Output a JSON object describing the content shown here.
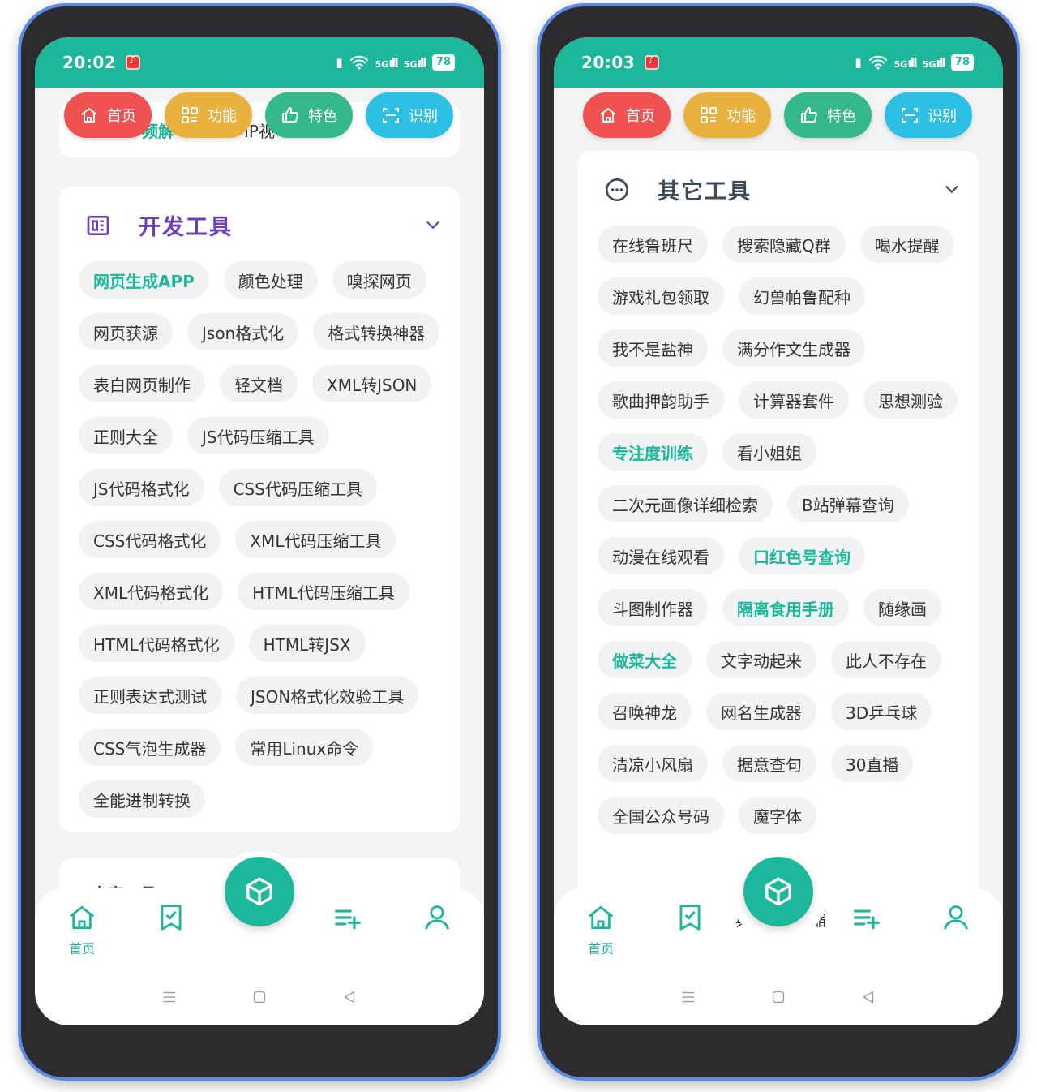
{
  "colors": {
    "brand": "#1db79b",
    "tab_home": "#f05252",
    "tab_function": "#e9b23f",
    "tab_feature": "#35b98a",
    "tab_recognize": "#2ec0e4",
    "dev_title": "#6b3fb8",
    "other_title": "#3d4a5a"
  },
  "tabs": [
    {
      "label": "首页",
      "icon": "home-icon"
    },
    {
      "label": "功能",
      "icon": "grid-icon"
    },
    {
      "label": "特色",
      "icon": "thumbs-up-icon"
    },
    {
      "label": "识别",
      "icon": "scan-icon"
    }
  ],
  "bottom_nav": {
    "home_label": "首页",
    "items": [
      "home-icon",
      "bookmark-check-icon",
      "cube-icon",
      "playlist-add-icon",
      "user-icon"
    ]
  },
  "left": {
    "status": {
      "time": "20:02",
      "signal_1": "5G",
      "signal_2": "5G",
      "battery": "78"
    },
    "peek": {
      "a": "频解",
      "b": "IP视"
    },
    "dev_tools": {
      "title": "开发工具",
      "chips": [
        {
          "label": "网页生成APP",
          "hl": true
        },
        {
          "label": "颜色处理"
        },
        {
          "label": "嗅探网页"
        },
        {
          "label": "网页获源"
        },
        {
          "label": "Json格式化"
        },
        {
          "label": "格式转换神器"
        },
        {
          "label": "表白网页制作"
        },
        {
          "label": "轻文档"
        },
        {
          "label": "XML转JSON"
        },
        {
          "label": "正则大全"
        },
        {
          "label": "JS代码压缩工具"
        },
        {
          "label": "JS代码格式化"
        },
        {
          "label": "CSS代码压缩工具"
        },
        {
          "label": "CSS代码格式化"
        },
        {
          "label": "XML代码压缩工具"
        },
        {
          "label": "XML代码格式化"
        },
        {
          "label": "HTML代码压缩工具"
        },
        {
          "label": "HTML代码格式化"
        },
        {
          "label": "HTML转JSX"
        },
        {
          "label": "正则表达式测试"
        },
        {
          "label": "JSON格式化效验工具"
        },
        {
          "label": "CSS气泡生成器"
        },
        {
          "label": "常用Linux命令"
        },
        {
          "label": "全能进制转换"
        }
      ]
    },
    "next_section_peek": "文字工具"
  },
  "right": {
    "status": {
      "time": "20:03",
      "signal_1": "5G",
      "signal_2": "5G",
      "battery": "78"
    },
    "other_tools": {
      "title": "其它工具",
      "chips": [
        {
          "label": "在线鲁班尺"
        },
        {
          "label": "搜索隐藏Q群"
        },
        {
          "label": "喝水提醒"
        },
        {
          "label": "游戏礼包领取"
        },
        {
          "label": "幻兽帕鲁配种"
        },
        {
          "label": "我不是盐神"
        },
        {
          "label": "满分作文生成器"
        },
        {
          "label": "歌曲押韵助手"
        },
        {
          "label": "计算器套件"
        },
        {
          "label": "思想测验"
        },
        {
          "label": "专注度训练",
          "hl": true
        },
        {
          "label": "看小姐姐"
        },
        {
          "label": "二次元画像详细检索"
        },
        {
          "label": "B站弹幕查询"
        },
        {
          "label": "动漫在线观看"
        },
        {
          "label": "口红色号查询",
          "hl": true
        },
        {
          "label": "斗图制作器"
        },
        {
          "label": "隔离食用手册",
          "hl": true
        },
        {
          "label": "随缘画"
        },
        {
          "label": "做菜大全",
          "hl": true
        },
        {
          "label": "文字动起来"
        },
        {
          "label": "此人不存在"
        },
        {
          "label": "召唤神龙"
        },
        {
          "label": "网名生成器"
        },
        {
          "label": "3D乒乓球"
        },
        {
          "label": "清凉小风扇"
        },
        {
          "label": "据意查句"
        },
        {
          "label": "30直播"
        },
        {
          "label": "全国公众号码"
        },
        {
          "label": "魔字体"
        }
      ]
    },
    "peek": {
      "a": "典",
      "b": "压缩"
    }
  }
}
